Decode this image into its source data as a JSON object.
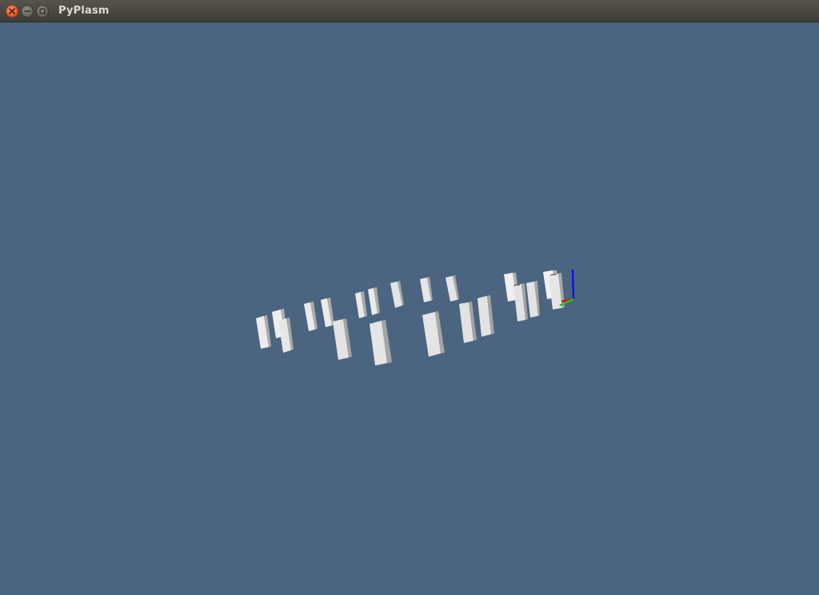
{
  "window": {
    "title": "PyPlasm",
    "background_color": "#4b6580",
    "controls": {
      "close_icon": "close-icon",
      "minimize_icon": "minimize-icon",
      "maximize_icon": "maximize-icon"
    }
  },
  "scene": {
    "description_kind": "3d-viewport",
    "object_count": 24,
    "axis_colors": {
      "x": "#d21a1a",
      "y": "#1fc21f",
      "z": "#1414e6"
    }
  }
}
